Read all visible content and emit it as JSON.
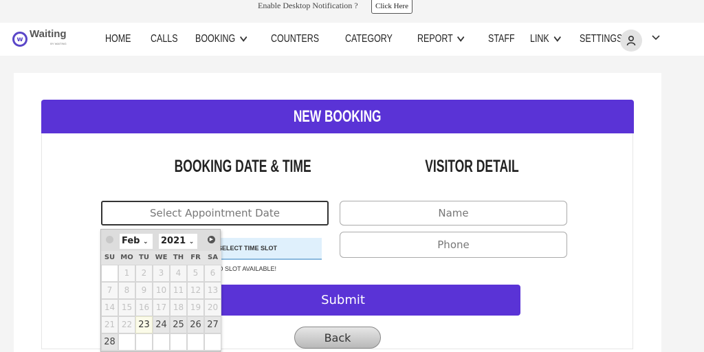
{
  "notification": {
    "text": "Enable Desktop Notification ?",
    "button_label": "Click Here"
  },
  "navbar": {
    "logo_text": "Waiting",
    "logo_letter": "w",
    "logo_sub": "BY WAITING",
    "items": [
      {
        "label": "HOME",
        "dropdown": false
      },
      {
        "label": "CALLS",
        "dropdown": false
      },
      {
        "label": "BOOKING",
        "dropdown": true
      },
      {
        "label": "COUNTERS",
        "dropdown": false
      },
      {
        "label": "CATEGORY",
        "dropdown": false
      },
      {
        "label": "REPORT",
        "dropdown": true
      },
      {
        "label": "STAFF",
        "dropdown": false
      },
      {
        "label": "LINK",
        "dropdown": true
      },
      {
        "label": "SETTINGS",
        "dropdown": true
      }
    ],
    "chevron": "⌄",
    "user_icon": "user-icon"
  },
  "card": {
    "title": "NEW BOOKING",
    "left_section_title": "BOOKING DATE & TIME",
    "right_section_title": "VISITOR DETAIL",
    "date_placeholder": "Select Appointment Date",
    "timeslot_label": "SELECT TIME SLOT",
    "no_slot_text": "NO SLOT AVAILABLE!",
    "name_placeholder": "Name",
    "phone_placeholder": "Phone",
    "submit_label": "Submit",
    "back_label": "Back"
  },
  "calendar": {
    "month": "Feb",
    "year": "2021",
    "weekdays": [
      "SU",
      "MO",
      "TU",
      "WE",
      "TH",
      "FR",
      "SA"
    ],
    "weeks": [
      [
        null,
        1,
        2,
        3,
        4,
        5,
        6
      ],
      [
        7,
        8,
        9,
        10,
        11,
        12,
        13
      ],
      [
        14,
        15,
        16,
        17,
        18,
        19,
        20
      ],
      [
        21,
        22,
        23,
        24,
        25,
        26,
        27
      ],
      [
        28,
        null,
        null,
        null,
        null,
        null,
        null
      ]
    ],
    "today": 23,
    "first_available": 23,
    "accent": "#5a33d6"
  }
}
